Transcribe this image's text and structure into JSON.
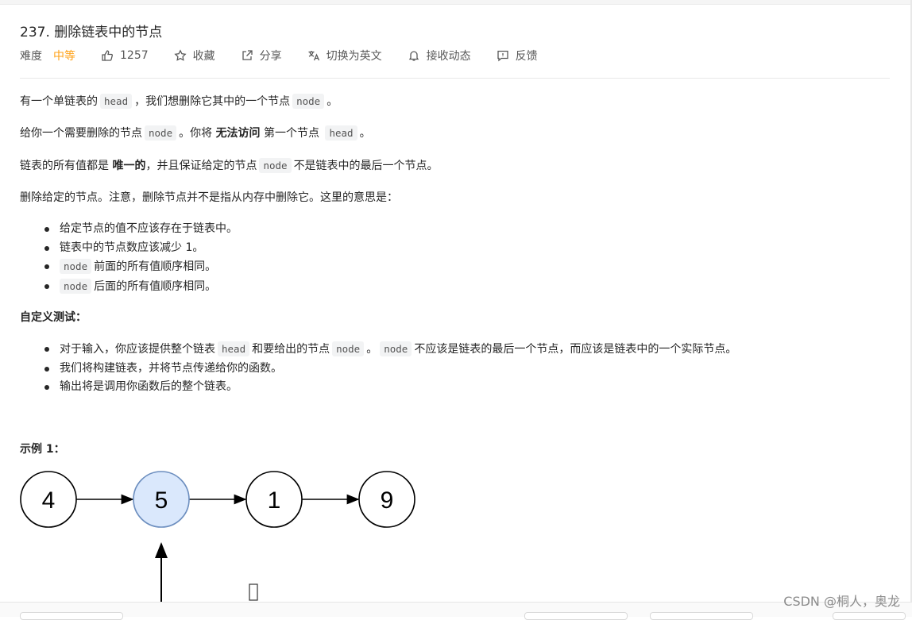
{
  "problem": {
    "title": "237. 删除链表中的节点",
    "difficulty_label": "难度",
    "difficulty_value": "中等",
    "likes": "1257",
    "favorite": "收藏",
    "share": "分享",
    "switch_lang": "切换为英文",
    "notify": "接收动态",
    "feedback": "反馈"
  },
  "desc": {
    "p1_a": "有一个单链表的",
    "p1_code1": "head",
    "p1_b": "，我们想删除它其中的一个节点",
    "p1_code2": "node",
    "p1_c": "。",
    "p2_a": "给你一个需要删除的节点",
    "p2_code1": "node",
    "p2_b": "。你将",
    "p2_bold": "无法访问",
    "p2_c": "第一个节点",
    "p2_code2": "head",
    "p2_d": "。",
    "p3_a": "链表的所有值都是",
    "p3_bold": "唯一的",
    "p3_b": "，并且保证给定的节点",
    "p3_code": "node",
    "p3_c": "不是链表中的最后一个节点。",
    "p4": "删除给定的节点。注意，删除节点并不是指从内存中删除它。这里的意思是：",
    "list1": {
      "item1": "给定节点的值不应该存在于链表中。",
      "item2": "链表中的节点数应该减少 1。",
      "item3_code": "node",
      "item3_text": "前面的所有值顺序相同。",
      "item4_code": "node",
      "item4_text": "后面的所有值顺序相同。"
    },
    "custom_test_heading": "自定义测试：",
    "list2": {
      "item1_a": "对于输入，你应该提供整个链表",
      "item1_code1": "head",
      "item1_b": "和要给出的节点",
      "item1_code2": "node",
      "item1_c": "。",
      "item1_code3": "node",
      "item1_d": "不应该是链表的最后一个节点，而应该是链表中的一个实际节点。",
      "item2": "我们将构建链表，并将节点传递给你的函数。",
      "item3": "输出将是调用你函数后的整个链表。"
    },
    "example_heading": "示例 1："
  },
  "diagram": {
    "nodes": [
      "4",
      "5",
      "1",
      "9"
    ],
    "highlighted_index": 1,
    "highlight_fill": "#dae8fc",
    "highlight_stroke": "#6c8ebf"
  },
  "watermark": "CSDN @桐人，奥龙",
  "colors": {
    "difficulty_medium": "#ffa116",
    "code_bg": "#f2f3f4",
    "text": "#262626"
  }
}
